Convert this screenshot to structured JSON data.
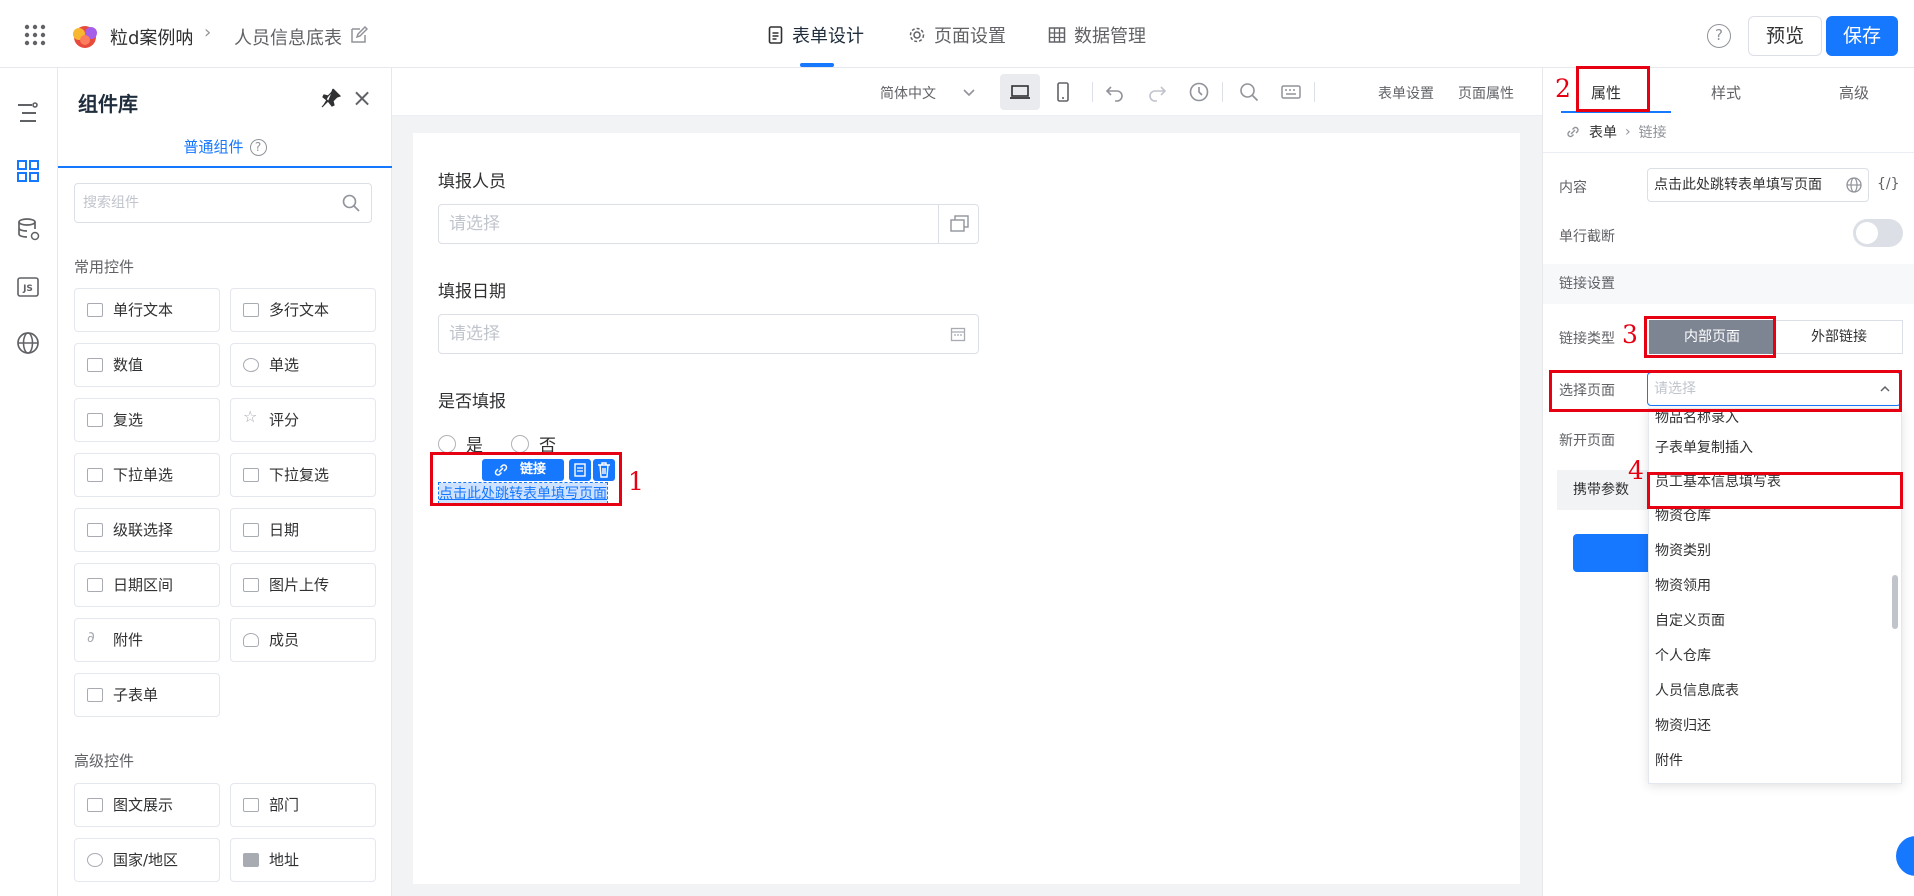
{
  "header": {
    "app_name": "粒d案例呐",
    "page_name": "人员信息底表",
    "tabs": [
      {
        "label": "表单设计"
      },
      {
        "label": "页面设置"
      },
      {
        "label": "数据管理"
      }
    ],
    "help": "?",
    "preview_label": "预览",
    "save_label": "保存"
  },
  "library": {
    "title": "组件库",
    "subtab": "普通组件",
    "search_placeholder": "搜索组件",
    "common_group": "常用控件",
    "common_items": [
      "单行文本",
      "多行文本",
      "数值",
      "单选",
      "复选",
      "评分",
      "下拉单选",
      "下拉复选",
      "级联选择",
      "日期",
      "日期区间",
      "图片上传",
      "附件",
      "成员",
      "子表单"
    ],
    "advanced_group": "高级控件",
    "advanced_items": [
      "图文展示",
      "部门",
      "国家/地区",
      "地址"
    ]
  },
  "toolbar": {
    "language": "简体中文",
    "form_settings": "表单设置",
    "page_props": "页面属性"
  },
  "form": {
    "field1_label": "填报人员",
    "field1_placeholder": "请选择",
    "field2_label": "填报日期",
    "field2_placeholder": "请选择",
    "field3_label": "是否填报",
    "option_yes": "是",
    "option_no": "否",
    "link_chip": "链接",
    "link_text": "点击此处跳转表单填写页面"
  },
  "annotations": [
    "1",
    "2",
    "3",
    "4"
  ],
  "props": {
    "tabs": [
      "属性",
      "样式",
      "高级"
    ],
    "breadcrumb_root": "表单",
    "breadcrumb_current": "链接",
    "content_label": "内容",
    "content_value": "点击此处跳转表单填写页面",
    "fx": "{/}",
    "single_line_label": "单行截断",
    "link_section": "链接设置",
    "link_type_label": "链接类型",
    "link_type_internal": "内部页面",
    "link_type_external": "外部链接",
    "select_page_label": "选择页面",
    "select_page_placeholder": "请选择",
    "new_page_label": "新开页面",
    "carry_params_label": "携带参数"
  },
  "dropdown": {
    "items": [
      "物品名称录入",
      "子表单复制插入",
      "员工基本信息填写表",
      "物资仓库",
      "物资类别",
      "物资领用",
      "自定义页面",
      "个人仓库",
      "人员信息底表",
      "物资归还",
      "附件"
    ]
  },
  "colors": {
    "accent": "#1677ff",
    "annotation": "#e60012",
    "segment_active": "#7d8593"
  }
}
